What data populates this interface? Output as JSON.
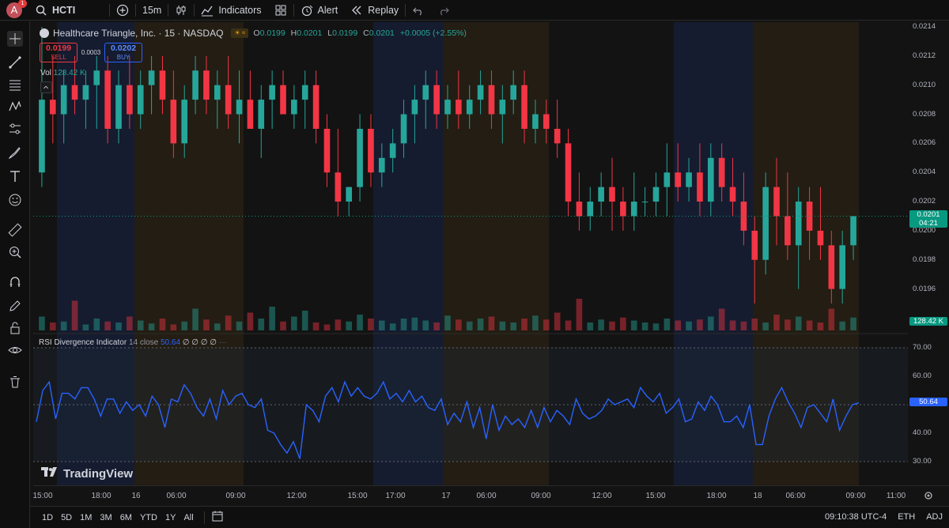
{
  "topbar": {
    "avatar_letter": "A",
    "notification_count": "1",
    "symbol": "HCTI",
    "interval": "15m",
    "indicators_label": "Indicators",
    "alert_label": "Alert",
    "replay_label": "Replay"
  },
  "legend": {
    "title": "Healthcare Triangle, Inc. · 15 · NASDAQ",
    "o_key": "O",
    "o_val": "0.0199",
    "h_key": "H",
    "h_val": "0.0201",
    "l_key": "L",
    "l_val": "0.0199",
    "c_key": "C",
    "c_val": "0.0201",
    "change": "+0.0005 (+2.55%)"
  },
  "trade": {
    "sell_price": "0.0199",
    "sell_label": "SELL",
    "spread": "0.0003",
    "buy_price": "0.0202",
    "buy_label": "BUY"
  },
  "volume": {
    "label": "Vol",
    "value": "128.42 K"
  },
  "rsi": {
    "name": "RSI Divergence Indicator",
    "params": "14 close",
    "value": "50.64",
    "extras": "∅ ∅ ∅ ∅"
  },
  "price_axis": {
    "ticks": [
      "0.0214",
      "0.0212",
      "0.0210",
      "0.0208",
      "0.0206",
      "0.0204",
      "0.0202",
      "0.0200",
      "0.0198",
      "0.0196"
    ],
    "last_price": "0.0201",
    "countdown": "04:21",
    "volume_label": "128.42 K"
  },
  "rsi_axis": {
    "ticks": [
      "70.00",
      "60.00",
      "50.00",
      "40.00",
      "30.00"
    ],
    "value_label": "50.64"
  },
  "time_axis": [
    "15:00",
    "18:00",
    "16",
    "06:00",
    "09:00",
    "12:00",
    "15:00",
    "17:00",
    "17",
    "06:00",
    "09:00",
    "12:00",
    "15:00",
    "18:00",
    "18",
    "06:00",
    "09:00",
    "11:00"
  ],
  "watermark": "TradingView",
  "bottombar": {
    "ranges": [
      "1D",
      "5D",
      "1M",
      "3M",
      "6M",
      "YTD",
      "1Y",
      "All"
    ],
    "clock": "09:10:38 UTC-4",
    "session": "ETH",
    "adj": "ADJ"
  },
  "colors": {
    "up": "#26a69a",
    "down": "#f23645",
    "rsi_line": "#2962ff",
    "last_price": "#089981",
    "asia_session": "#17203a",
    "london_session": "#2a2114"
  },
  "chart_data": {
    "type": "candlestick",
    "symbol": "HCTI",
    "interval": "15",
    "ohlc": [
      [
        0.0204,
        0.0214,
        0.0203,
        0.0209
      ],
      [
        0.0209,
        0.0212,
        0.0206,
        0.0208
      ],
      [
        0.0208,
        0.0211,
        0.0206,
        0.021
      ],
      [
        0.021,
        0.0212,
        0.0208,
        0.0209
      ],
      [
        0.0209,
        0.0211,
        0.0207,
        0.021
      ],
      [
        0.021,
        0.0212,
        0.0207,
        0.0211
      ],
      [
        0.0211,
        0.0212,
        0.0206,
        0.0207
      ],
      [
        0.0207,
        0.0211,
        0.0206,
        0.021
      ],
      [
        0.021,
        0.0212,
        0.0207,
        0.0208
      ],
      [
        0.0208,
        0.0211,
        0.0207,
        0.021
      ],
      [
        0.021,
        0.0212,
        0.0208,
        0.0211
      ],
      [
        0.0211,
        0.0212,
        0.0208,
        0.0209
      ],
      [
        0.0209,
        0.0211,
        0.0205,
        0.0206
      ],
      [
        0.0206,
        0.021,
        0.0205,
        0.0209
      ],
      [
        0.0209,
        0.0212,
        0.0208,
        0.0211
      ],
      [
        0.0211,
        0.0212,
        0.0208,
        0.0209
      ],
      [
        0.0209,
        0.0211,
        0.0207,
        0.021
      ],
      [
        0.021,
        0.0212,
        0.0207,
        0.0208
      ],
      [
        0.0208,
        0.0211,
        0.0206,
        0.0209
      ],
      [
        0.0209,
        0.0211,
        0.0207,
        0.0207
      ],
      [
        0.0207,
        0.021,
        0.0205,
        0.0209
      ],
      [
        0.0209,
        0.0211,
        0.0207,
        0.021
      ],
      [
        0.021,
        0.0211,
        0.0208,
        0.0208
      ],
      [
        0.0208,
        0.021,
        0.0207,
        0.0209
      ],
      [
        0.0209,
        0.0211,
        0.0207,
        0.021
      ],
      [
        0.021,
        0.0211,
        0.0206,
        0.0207
      ],
      [
        0.0207,
        0.0208,
        0.0203,
        0.0204
      ],
      [
        0.0204,
        0.0207,
        0.0201,
        0.0202
      ],
      [
        0.0202,
        0.0203,
        0.0201,
        0.0203
      ],
      [
        0.0203,
        0.0208,
        0.0202,
        0.0207
      ],
      [
        0.0207,
        0.0208,
        0.0203,
        0.0204
      ],
      [
        0.0204,
        0.0206,
        0.0203,
        0.0205
      ],
      [
        0.0205,
        0.0207,
        0.0204,
        0.0206
      ],
      [
        0.0206,
        0.0209,
        0.0205,
        0.0208
      ],
      [
        0.0208,
        0.021,
        0.0206,
        0.0209
      ],
      [
        0.0209,
        0.0211,
        0.0207,
        0.021
      ],
      [
        0.021,
        0.0211,
        0.0207,
        0.0208
      ],
      [
        0.0208,
        0.021,
        0.0207,
        0.0209
      ],
      [
        0.0209,
        0.0211,
        0.0207,
        0.0208
      ],
      [
        0.0208,
        0.021,
        0.0207,
        0.0209
      ],
      [
        0.0209,
        0.0211,
        0.0208,
        0.021
      ],
      [
        0.021,
        0.0211,
        0.0207,
        0.0208
      ],
      [
        0.0208,
        0.021,
        0.0206,
        0.0209
      ],
      [
        0.0209,
        0.0211,
        0.0208,
        0.021
      ],
      [
        0.021,
        0.0211,
        0.0206,
        0.0207
      ],
      [
        0.0207,
        0.0209,
        0.0206,
        0.0208
      ],
      [
        0.0208,
        0.0209,
        0.0206,
        0.0207
      ],
      [
        0.0207,
        0.0209,
        0.0205,
        0.0206
      ],
      [
        0.0206,
        0.0207,
        0.0201,
        0.0202
      ],
      [
        0.0202,
        0.0204,
        0.02,
        0.0201
      ],
      [
        0.0201,
        0.0203,
        0.02,
        0.0202
      ],
      [
        0.0202,
        0.0204,
        0.0201,
        0.0203
      ],
      [
        0.0203,
        0.0205,
        0.02,
        0.0202
      ],
      [
        0.0202,
        0.0203,
        0.02,
        0.0201
      ],
      [
        0.0201,
        0.0204,
        0.02,
        0.0202
      ],
      [
        0.0202,
        0.0203,
        0.0201,
        0.0202
      ],
      [
        0.0202,
        0.0204,
        0.0201,
        0.0203
      ],
      [
        0.0203,
        0.0206,
        0.0201,
        0.0204
      ],
      [
        0.0204,
        0.0206,
        0.0202,
        0.0203
      ],
      [
        0.0203,
        0.0205,
        0.0202,
        0.0204
      ],
      [
        0.0204,
        0.0206,
        0.0201,
        0.0202
      ],
      [
        0.0202,
        0.0206,
        0.0201,
        0.0205
      ],
      [
        0.0205,
        0.0206,
        0.0202,
        0.0203
      ],
      [
        0.0203,
        0.0205,
        0.0201,
        0.0202
      ],
      [
        0.0202,
        0.0204,
        0.0199,
        0.02
      ],
      [
        0.02,
        0.0201,
        0.0195,
        0.0198
      ],
      [
        0.0198,
        0.0204,
        0.0197,
        0.0203
      ],
      [
        0.0203,
        0.0205,
        0.0199,
        0.0201
      ],
      [
        0.0201,
        0.0204,
        0.0198,
        0.0199
      ],
      [
        0.0199,
        0.0203,
        0.0196,
        0.0202
      ],
      [
        0.0202,
        0.0203,
        0.0198,
        0.02
      ],
      [
        0.02,
        0.0203,
        0.0198,
        0.0199
      ],
      [
        0.0199,
        0.02,
        0.0195,
        0.0196
      ],
      [
        0.0196,
        0.02,
        0.0195,
        0.0199
      ],
      [
        0.0199,
        0.0201,
        0.0198,
        0.0201
      ]
    ],
    "volume": [
      14,
      8,
      9,
      30,
      6,
      12,
      9,
      8,
      14,
      10,
      7,
      12,
      6,
      9,
      22,
      11,
      7,
      15,
      9,
      18,
      12,
      24,
      9,
      14,
      20,
      8,
      6,
      11,
      9,
      16,
      12,
      10,
      7,
      12,
      13,
      10,
      8,
      15,
      11,
      9,
      12,
      14,
      9,
      8,
      12,
      15,
      11,
      18,
      10,
      32,
      8,
      11,
      9,
      13,
      10,
      8,
      7,
      12,
      10,
      9,
      11,
      14,
      22,
      10,
      9,
      12,
      8,
      16,
      11,
      14,
      10,
      8,
      22,
      9,
      13
    ],
    "rsi": [
      44,
      55,
      58,
      45,
      54,
      54,
      52,
      56,
      56,
      52,
      46,
      52,
      52,
      47,
      51,
      48,
      50,
      46,
      53,
      50,
      42,
      52,
      51,
      57,
      54,
      49,
      46,
      52,
      45,
      55,
      50,
      53,
      54,
      50,
      49,
      52,
      41,
      40,
      36,
      33,
      37,
      31,
      50,
      48,
      44,
      53,
      56,
      51,
      58,
      53,
      56,
      53,
      52,
      54,
      58,
      52,
      54,
      51,
      55,
      51,
      53,
      49,
      48,
      52,
      43,
      47,
      44,
      51,
      42,
      49,
      38,
      50,
      41,
      46,
      43,
      45,
      42,
      48,
      42,
      49,
      44,
      48,
      46,
      43,
      52,
      47,
      45,
      46,
      48,
      52,
      50,
      51,
      52,
      49,
      56,
      53,
      51,
      54,
      47,
      49,
      52,
      44,
      45,
      51,
      48,
      53,
      50,
      44,
      44,
      46,
      42,
      50,
      36,
      36,
      46,
      52,
      56,
      51,
      47,
      42,
      49,
      50,
      47,
      44,
      52,
      41,
      46,
      50,
      50.64
    ],
    "price_range": [
      0.0195,
      0.0214
    ],
    "rsi_range": [
      30,
      70
    ],
    "rsi_bands": [
      30,
      50,
      70
    ],
    "last_price": 0.0201
  }
}
